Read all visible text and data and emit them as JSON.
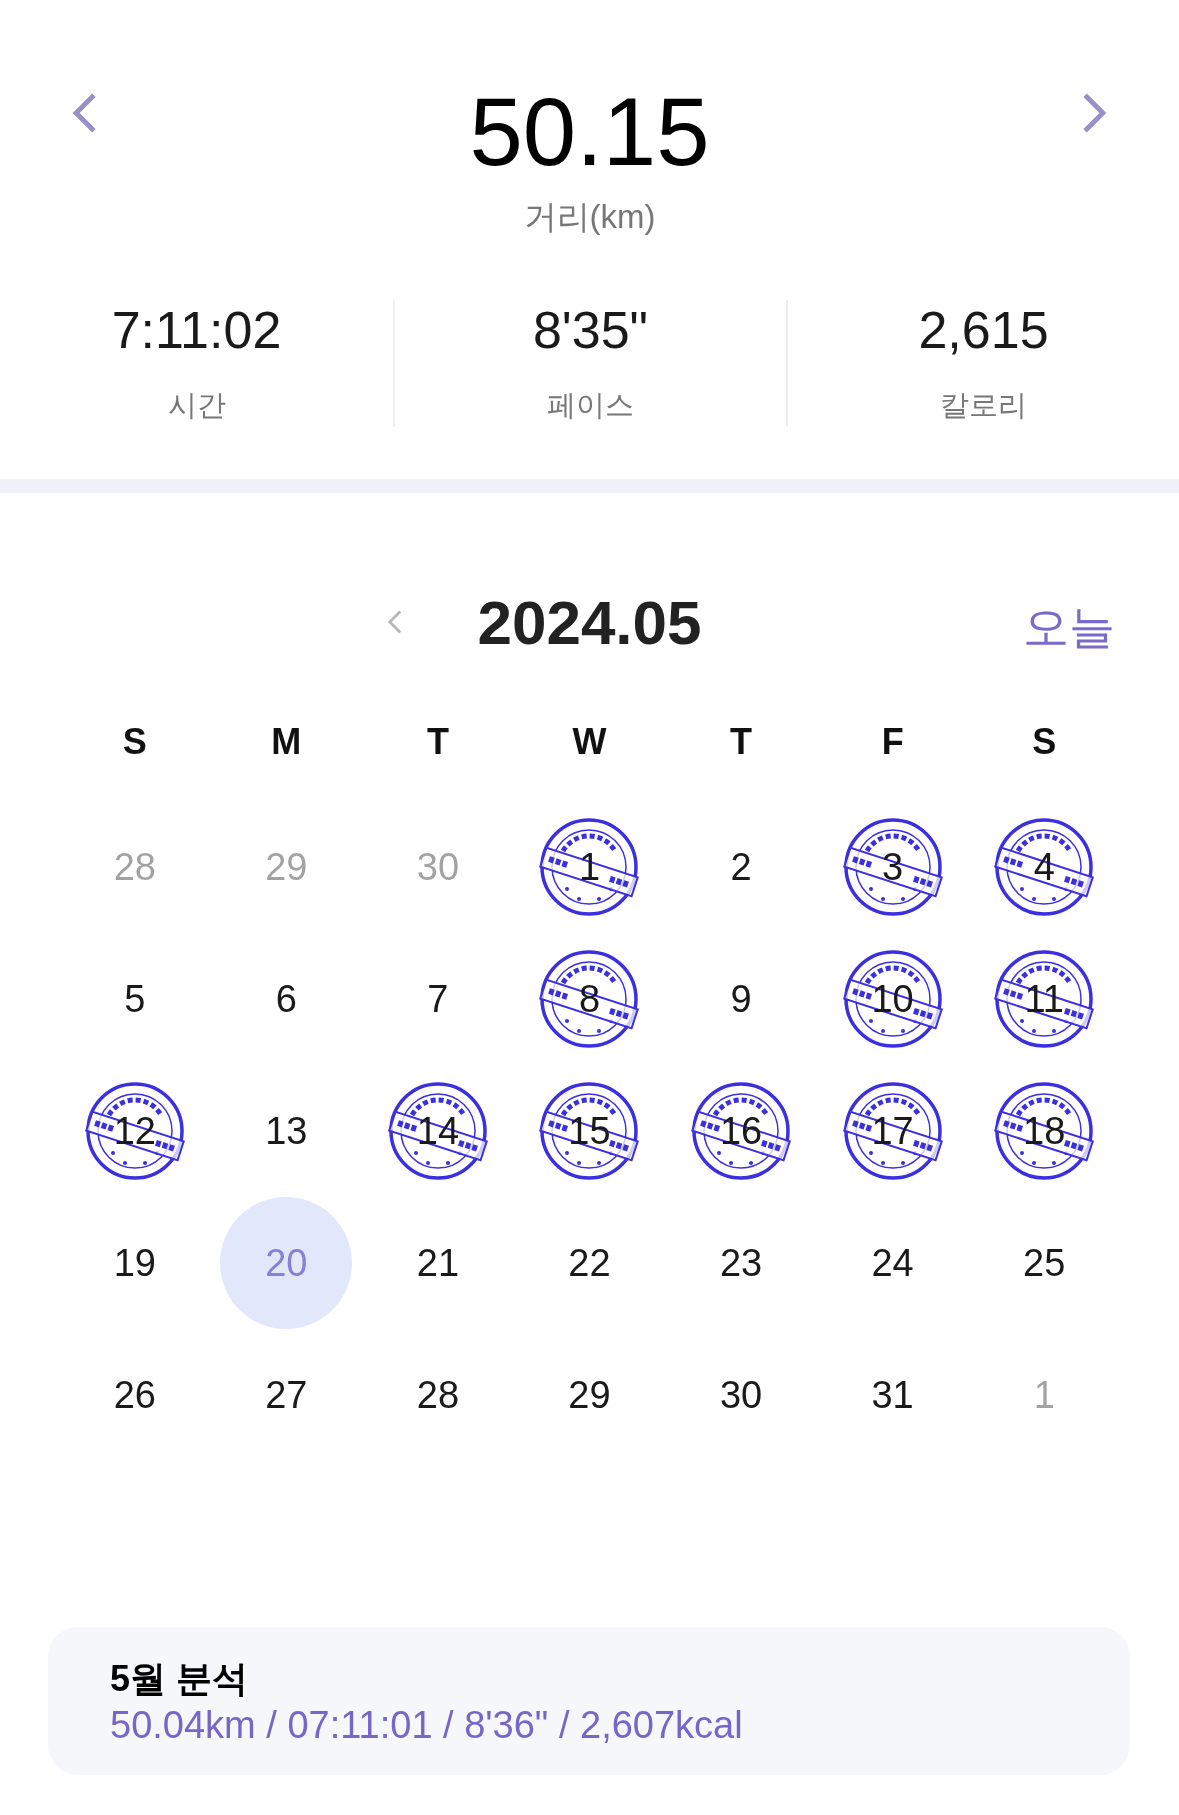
{
  "summary": {
    "distance": "50.15",
    "distance_label": "거리(km)",
    "stats": [
      {
        "value": "7:11:02",
        "label": "시간"
      },
      {
        "value": "8'35\"",
        "label": "페이스"
      },
      {
        "value": "2,615",
        "label": "칼로리"
      }
    ]
  },
  "calendar": {
    "month": "2024.05",
    "today_button": "오늘",
    "weekdays": [
      "S",
      "M",
      "T",
      "W",
      "T",
      "F",
      "S"
    ],
    "days": [
      {
        "label": "28",
        "muted": true,
        "selected": false,
        "stamped": false
      },
      {
        "label": "29",
        "muted": true,
        "selected": false,
        "stamped": false
      },
      {
        "label": "30",
        "muted": true,
        "selected": false,
        "stamped": false
      },
      {
        "label": "1",
        "muted": false,
        "selected": false,
        "stamped": true
      },
      {
        "label": "2",
        "muted": false,
        "selected": false,
        "stamped": false
      },
      {
        "label": "3",
        "muted": false,
        "selected": false,
        "stamped": true
      },
      {
        "label": "4",
        "muted": false,
        "selected": false,
        "stamped": true
      },
      {
        "label": "5",
        "muted": false,
        "selected": false,
        "stamped": false
      },
      {
        "label": "6",
        "muted": false,
        "selected": false,
        "stamped": false
      },
      {
        "label": "7",
        "muted": false,
        "selected": false,
        "stamped": false
      },
      {
        "label": "8",
        "muted": false,
        "selected": false,
        "stamped": true
      },
      {
        "label": "9",
        "muted": false,
        "selected": false,
        "stamped": false
      },
      {
        "label": "10",
        "muted": false,
        "selected": false,
        "stamped": true
      },
      {
        "label": "11",
        "muted": false,
        "selected": false,
        "stamped": true
      },
      {
        "label": "12",
        "muted": false,
        "selected": false,
        "stamped": true
      },
      {
        "label": "13",
        "muted": false,
        "selected": false,
        "stamped": false
      },
      {
        "label": "14",
        "muted": false,
        "selected": false,
        "stamped": true
      },
      {
        "label": "15",
        "muted": false,
        "selected": false,
        "stamped": true
      },
      {
        "label": "16",
        "muted": false,
        "selected": false,
        "stamped": true
      },
      {
        "label": "17",
        "muted": false,
        "selected": false,
        "stamped": true
      },
      {
        "label": "18",
        "muted": false,
        "selected": false,
        "stamped": true
      },
      {
        "label": "19",
        "muted": false,
        "selected": false,
        "stamped": false
      },
      {
        "label": "20",
        "muted": false,
        "selected": true,
        "stamped": false
      },
      {
        "label": "21",
        "muted": false,
        "selected": false,
        "stamped": false
      },
      {
        "label": "22",
        "muted": false,
        "selected": false,
        "stamped": false
      },
      {
        "label": "23",
        "muted": false,
        "selected": false,
        "stamped": false
      },
      {
        "label": "24",
        "muted": false,
        "selected": false,
        "stamped": false
      },
      {
        "label": "25",
        "muted": false,
        "selected": false,
        "stamped": false
      },
      {
        "label": "26",
        "muted": false,
        "selected": false,
        "stamped": false
      },
      {
        "label": "27",
        "muted": false,
        "selected": false,
        "stamped": false
      },
      {
        "label": "28",
        "muted": false,
        "selected": false,
        "stamped": false
      },
      {
        "label": "29",
        "muted": false,
        "selected": false,
        "stamped": false
      },
      {
        "label": "30",
        "muted": false,
        "selected": false,
        "stamped": false
      },
      {
        "label": "31",
        "muted": false,
        "selected": false,
        "stamped": false
      },
      {
        "label": "1",
        "muted": true,
        "selected": false,
        "stamped": false
      }
    ]
  },
  "analysis": {
    "title": "5월 분석",
    "text": "50.04km / 07:11:01 / 8'36\" / 2,607kcal"
  }
}
